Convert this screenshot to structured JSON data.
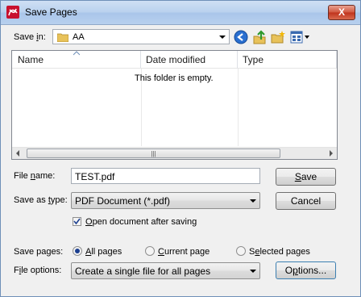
{
  "window": {
    "title": "Save Pages",
    "close_label": "X"
  },
  "save_in": {
    "label_prefix": "Save ",
    "label_key": "i",
    "label_suffix": "n:",
    "folder": "AA"
  },
  "toolbar": {
    "back": "back-icon",
    "up": "up-folder-icon",
    "new_folder": "new-folder-icon",
    "views": "views-menu-icon"
  },
  "list": {
    "columns": [
      "Name",
      "Date modified",
      "Type"
    ],
    "empty_message": "This folder is empty."
  },
  "file_name": {
    "label_prefix": "File ",
    "label_key": "n",
    "label_suffix": "ame:",
    "value": "TEST.pdf"
  },
  "save_as_type": {
    "label_prefix": "Save as ",
    "label_key": "t",
    "label_suffix": "ype:",
    "value": "PDF Document (*.pdf)"
  },
  "buttons": {
    "save": {
      "key": "S",
      "rest": "ave"
    },
    "cancel": "Cancel",
    "options": {
      "prefix": "O",
      "key": "p",
      "rest": "tions..."
    }
  },
  "open_after": {
    "key": "O",
    "rest": "pen document after saving",
    "checked": true
  },
  "save_pages": {
    "label": "Save pages:",
    "options": [
      {
        "key": "A",
        "rest": "ll pages",
        "selected": true
      },
      {
        "key": "C",
        "rest": "urrent page",
        "selected": false
      },
      {
        "prefix": "S",
        "key": "e",
        "rest": "lected pages",
        "selected": false
      }
    ]
  },
  "file_options": {
    "label_prefix": "F",
    "label_key": "i",
    "label_suffix": "le options:",
    "value": "Create a single file for all pages"
  }
}
